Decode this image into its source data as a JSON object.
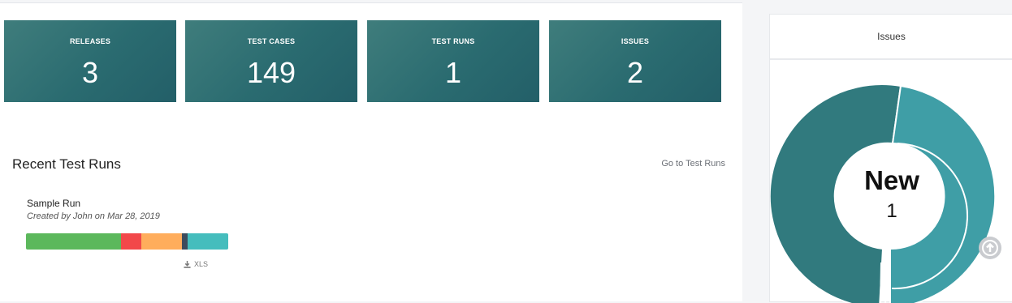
{
  "stats": [
    {
      "label": "RELEASES",
      "value": "3"
    },
    {
      "label": "TEST CASES",
      "value": "149"
    },
    {
      "label": "TEST RUNS",
      "value": "1"
    },
    {
      "label": "ISSUES",
      "value": "2"
    }
  ],
  "recent": {
    "title": "Recent Test Runs",
    "link_label": "Go to Test Runs",
    "run": {
      "name": "Sample Run",
      "meta": "Created by John on Mar 28, 2019",
      "export_label": "XLS",
      "progress_fractions": [
        0.47,
        0.1,
        0.2,
        0.03,
        0.2
      ],
      "progress_colors": [
        "#5cb85c",
        "#f2484a",
        "#ffad5c",
        "#3d4b5c",
        "#45bdbd"
      ]
    }
  },
  "issues_panel": {
    "title": "Issues",
    "center_label": "New",
    "center_value": "1"
  },
  "colors": {
    "accent_teal": "#2f6f75",
    "donut_dark": "#317a7e",
    "donut_light": "#3f9ea6"
  },
  "icons": {
    "export": "download-icon",
    "scroll": "arrow-up-icon"
  }
}
